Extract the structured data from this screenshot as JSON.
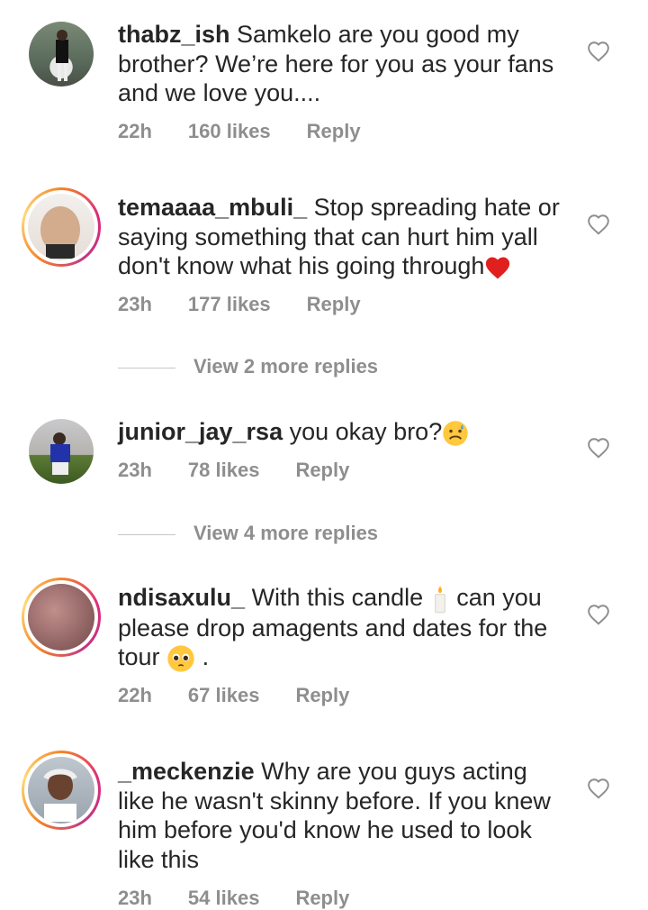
{
  "comments": [
    {
      "username": "thabz_ish",
      "text": "Samkelo are you good my brother?  We’re here for you as your fans and we love you....",
      "time": "22h",
      "likes": "160 likes",
      "reply": "Reply"
    },
    {
      "username": "temaaaa_mbuli_",
      "text": "Stop spreading hate or saying something that can hurt him yall don't know what his going through",
      "time": "23h",
      "likes": "177 likes",
      "reply": "Reply"
    },
    {
      "username": "junior_jay_rsa",
      "text": "you okay bro?",
      "time": "23h",
      "likes": "78 likes",
      "reply": "Reply"
    },
    {
      "username": "ndisaxulu_",
      "text": "With this candle",
      "text2": "can you please drop amagents and dates for the tour",
      "text3": ".",
      "time": "22h",
      "likes": "67 likes",
      "reply": "Reply"
    },
    {
      "username": "_meckenzie",
      "text": "Why are you guys acting like he wasn't skinny before. If you knew him before you'd know he used to look like this",
      "time": "23h",
      "likes": "54 likes",
      "reply": "Reply"
    }
  ],
  "view_more": [
    "View 2 more replies",
    "View 4 more replies"
  ],
  "icons": {
    "like": "heart-outline-icon",
    "heart_emoji": "red-heart-emoji",
    "sad_emoji": "sad-sweat-face-emoji",
    "candle_emoji": "candle-emoji",
    "pleading_emoji": "pleading-face-emoji"
  }
}
